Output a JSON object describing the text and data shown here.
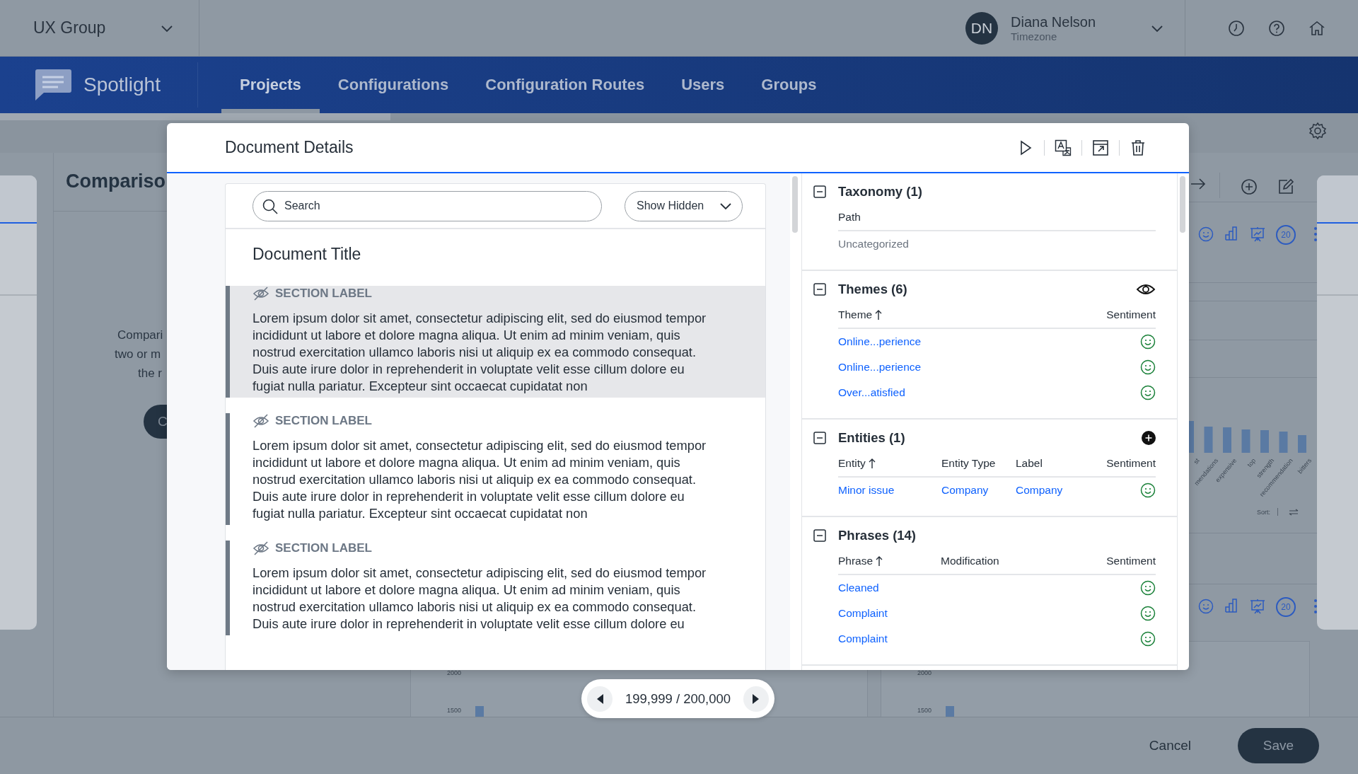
{
  "top_bar": {
    "org": "UX Group",
    "user": {
      "initials": "DN",
      "name": "Diana Nelson",
      "subtitle": "Timezone"
    }
  },
  "nav": {
    "brand": "Spotlight",
    "tabs": [
      {
        "label": "Projects",
        "selected": true
      },
      {
        "label": "Configurations",
        "selected": false
      },
      {
        "label": "Configuration Routes",
        "selected": false
      },
      {
        "label": "Users",
        "selected": false
      },
      {
        "label": "Groups",
        "selected": false
      }
    ]
  },
  "background": {
    "panel_title": "Compariso",
    "text_lines": [
      "Compari",
      "two or m",
      "the r"
    ],
    "button": "C",
    "badges": [
      "20",
      "20"
    ],
    "chart_labels": [
      "st",
      "mendations",
      "expensive",
      "top",
      "strength",
      "recommendation",
      "bitters"
    ],
    "sort_label": "Sort:",
    "mini_charts": [
      {
        "ticks": [
          "2000",
          "1500"
        ]
      },
      {
        "ticks": [
          "2000",
          "1500"
        ]
      }
    ]
  },
  "modal": {
    "title": "Document Details",
    "search": {
      "placeholder": "Search"
    },
    "filter": "Show Hidden",
    "document_title": "Document Title",
    "sections": [
      {
        "label": "SECTION LABEL",
        "hidden": true,
        "selected": true,
        "lines": [
          "Lorem ipsum dolor sit amet, consectetur adipiscing elit, sed do eiusmod tempor",
          "incididunt ut labore et dolore magna aliqua. Ut enim ad minim veniam, quis",
          "nostrud exercitation ullamco laboris nisi ut aliquip ex ea commodo consequat.",
          "Duis aute irure dolor in reprehenderit in voluptate velit esse cillum dolore eu",
          "fugiat nulla pariatur. Excepteur sint occaecat cupidatat non"
        ]
      },
      {
        "label": "SECTION LABEL",
        "hidden": true,
        "selected": false,
        "lines": [
          "Lorem ipsum dolor sit amet, consectetur adipiscing elit, sed do eiusmod tempor",
          "incididunt ut labore et dolore magna aliqua. Ut enim ad minim veniam, quis",
          "nostrud exercitation ullamco laboris nisi ut aliquip ex ea commodo consequat.",
          "Duis aute irure dolor in reprehenderit in voluptate velit esse cillum dolore eu",
          "fugiat nulla pariatur. Excepteur sint occaecat cupidatat non"
        ]
      },
      {
        "label": "SECTION LABEL",
        "hidden": true,
        "selected": false,
        "lines": [
          "Lorem ipsum dolor sit amet, consectetur adipiscing elit, sed do eiusmod tempor",
          "incididunt ut labore et dolore magna aliqua. Ut enim ad minim veniam, quis",
          "nostrud exercitation ullamco laboris nisi ut aliquip ex ea commodo consequat.",
          "Duis aute irure dolor in reprehenderit in voluptate velit esse cillum dolore eu"
        ]
      }
    ],
    "panel": [
      {
        "title": "Taxonomy (1)",
        "expanded": true,
        "kind": "text",
        "columns": [
          {
            "label": "Path",
            "sorted": false
          }
        ],
        "rows": [
          {
            "cells": [
              "Uncategorized"
            ]
          }
        ]
      },
      {
        "title": "Themes (6)",
        "expanded": true,
        "kind": "eye",
        "columns": [
          {
            "label": "Theme",
            "sorted": true
          },
          {
            "label": "Sentiment",
            "sorted": false
          }
        ],
        "rows": [
          {
            "cells": [
              "Online...perience"
            ],
            "kind": "positive"
          },
          {
            "cells": [
              "Online...perience"
            ],
            "kind": "positive"
          },
          {
            "cells": [
              "Over...atisfied"
            ],
            "kind": "positive"
          }
        ]
      },
      {
        "title": "Entities (1)",
        "expanded": true,
        "kind": "add",
        "columns": [
          {
            "label": "Entity",
            "sorted": true
          },
          {
            "label": "Entity Type",
            "sorted": false
          },
          {
            "label": "Label",
            "sorted": false
          },
          {
            "label": "Sentiment",
            "sorted": false
          }
        ],
        "rows": [
          {
            "cells": [
              "Minor issue",
              "Company",
              "Company"
            ],
            "kind": "positive"
          }
        ]
      },
      {
        "title": "Phrases (14)",
        "expanded": true,
        "kind": "link",
        "columns": [
          {
            "label": "Phrase",
            "sorted": true
          },
          {
            "label": "Modification",
            "sorted": false
          },
          {
            "label": "Sentiment",
            "sorted": false
          }
        ],
        "rows": [
          {
            "cells": [
              "Cleaned"
            ],
            "kind": "positive"
          },
          {
            "cells": [
              "Complaint"
            ],
            "kind": "positive"
          },
          {
            "cells": [
              "Complaint"
            ],
            "kind": "positive"
          }
        ]
      }
    ]
  },
  "pager": {
    "text": "199,999 / 200,000"
  },
  "footer": {
    "buttons": [
      {
        "label": "Cancel",
        "kind": "ghost"
      },
      {
        "label": "Save",
        "kind": "primary"
      }
    ]
  }
}
